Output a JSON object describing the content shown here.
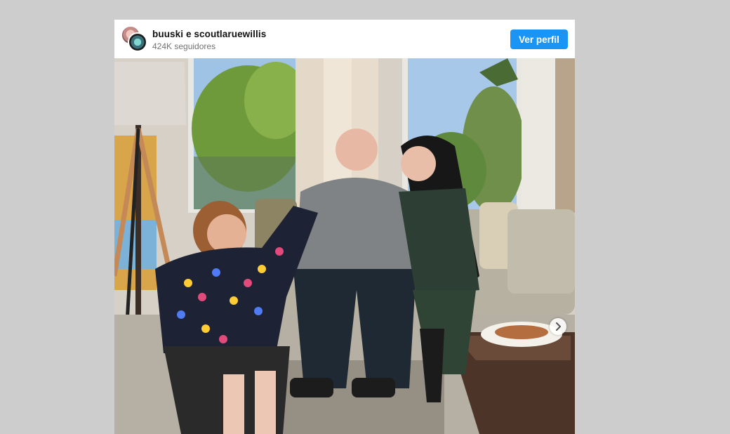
{
  "post": {
    "account_name": "buuski e scoutlaruewillis",
    "followers": "424K seguidores",
    "profile_button": "Ver perfil",
    "icons": {
      "avatar_primary": "avatar-icon",
      "avatar_secondary": "avatar-icon",
      "next": "chevron-right-icon"
    },
    "colors": {
      "button": "#1a95f5",
      "background": "#cdcdcd",
      "card": "#ffffff"
    }
  }
}
